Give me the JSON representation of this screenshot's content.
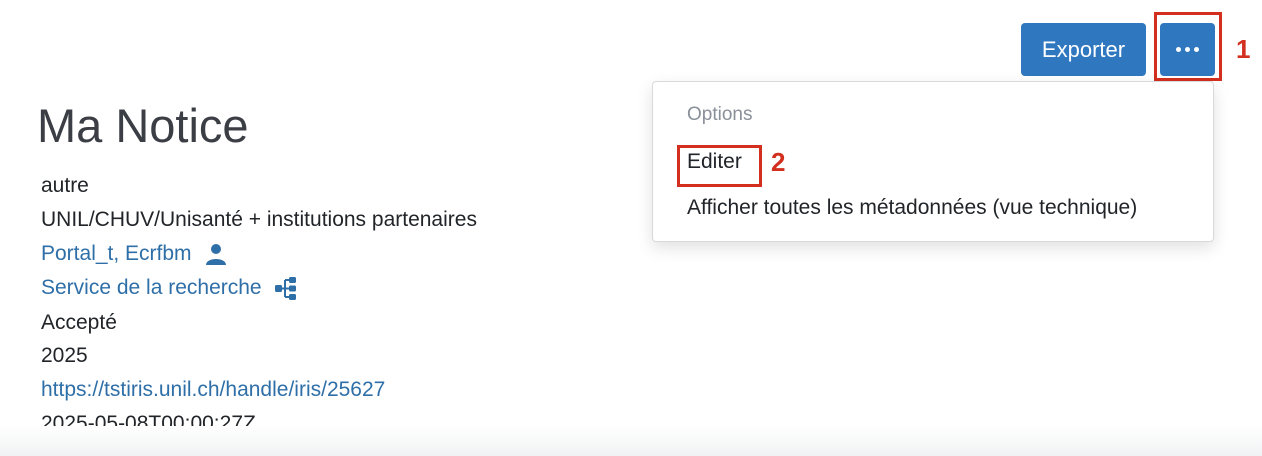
{
  "toolbar": {
    "export_label": "Exporter",
    "more_icon": "ellipsis-icon"
  },
  "dropdown": {
    "header": "Options",
    "items": [
      {
        "label": "Editer"
      },
      {
        "label": "Afficher toutes les métadonnées (vue technique)"
      }
    ]
  },
  "annotations": [
    "1",
    "2"
  ],
  "record": {
    "title": "Ma Notice",
    "type": "autre",
    "institution": "UNIL/CHUV/Unisanté + institutions partenaires",
    "authors": "Portal_t, Ecrfbm",
    "author_icon": "person-icon",
    "unit": "Service de la recherche",
    "unit_icon": "hierarchy-icon",
    "status": "Accepté",
    "year": "2025",
    "url": "https://tstiris.unil.ch/handle/iris/25627",
    "date": "2025-05-08T00:00:27Z"
  },
  "colors": {
    "primary": "#2f78c0",
    "link": "#2f6fa8",
    "annotation": "#d32f1e"
  }
}
